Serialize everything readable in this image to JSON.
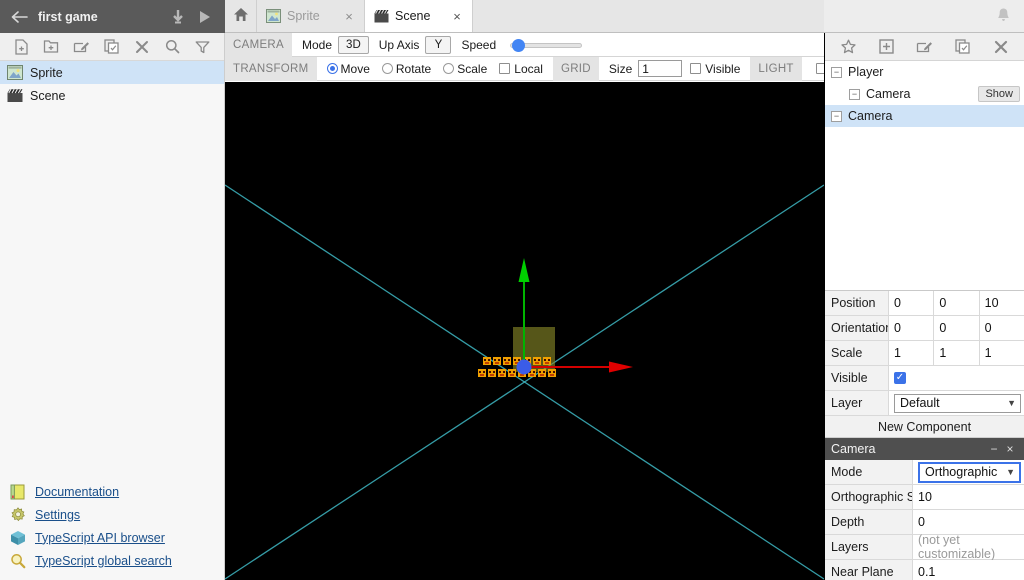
{
  "topbar": {
    "back_icon": "back-arrow-icon",
    "project_title": "first game",
    "export_icon": "download-icon",
    "play_icon": "play-icon",
    "bell_icon": "notification-bell-icon"
  },
  "tabs": {
    "home_icon": "home-icon",
    "items": [
      {
        "label": "Sprite",
        "icon": "image-icon",
        "active": false,
        "close": "×"
      },
      {
        "label": "Scene",
        "icon": "clapperboard-icon",
        "active": true,
        "close": "×"
      }
    ]
  },
  "sidebar": {
    "toolbar": [
      {
        "name": "new-asset-icon"
      },
      {
        "name": "new-folder-icon"
      },
      {
        "name": "rename-icon"
      },
      {
        "name": "duplicate-icon"
      },
      {
        "name": "delete-icon"
      },
      {
        "name": "search-icon"
      },
      {
        "name": "filter-icon"
      }
    ],
    "assets": [
      {
        "label": "Sprite",
        "icon": "image-icon",
        "selected": true
      },
      {
        "label": "Scene",
        "icon": "clapperboard-icon",
        "selected": false
      }
    ],
    "links": [
      {
        "label": "Documentation",
        "icon": "book-icon"
      },
      {
        "label": "Settings",
        "icon": "gear-icon"
      },
      {
        "label": "TypeScript API browser",
        "icon": "package-icon"
      },
      {
        "label": "TypeScript global search",
        "icon": "magnifier-icon"
      }
    ]
  },
  "scene_toolbar": {
    "camera": {
      "section": "CAMERA",
      "mode_label": "Mode",
      "mode_value": "3D",
      "up_axis_label": "Up Axis",
      "up_axis_value": "Y",
      "speed_label": "Speed",
      "speed_percent": 8
    },
    "transform": {
      "section": "TRANSFORM",
      "modes": [
        {
          "label": "Move",
          "selected": true
        },
        {
          "label": "Rotate",
          "selected": false
        },
        {
          "label": "Scale",
          "selected": false
        }
      ],
      "local_label": "Local",
      "local_checked": false
    },
    "grid": {
      "section": "GRID",
      "size_label": "Size",
      "size_value": "1",
      "visible_label": "Visible",
      "visible_checked": false
    },
    "light": {
      "section": "LIGHT",
      "enabled": false
    }
  },
  "viewport": {
    "background": "#000000",
    "x_axis_color": "#d40000",
    "y_axis_color": "#00b400",
    "center_handle_color": "#3b5ce8",
    "plane_handle_color": "#8a8a28",
    "frustum_color": "#3fb8c4",
    "sprite_color": "#f0a000"
  },
  "hierarchy": {
    "toolbar": [
      {
        "name": "new-actor-icon"
      },
      {
        "name": "new-component-icon"
      },
      {
        "name": "rename-icon"
      },
      {
        "name": "duplicate-icon"
      },
      {
        "name": "delete-icon"
      }
    ],
    "nodes": [
      {
        "label": "Player",
        "indent": 0,
        "selected": false,
        "action": ""
      },
      {
        "label": "Camera",
        "indent": 1,
        "selected": false,
        "action": "Show"
      },
      {
        "label": "Camera",
        "indent": 0,
        "selected": true,
        "action": ""
      }
    ]
  },
  "inspector": {
    "transform": [
      {
        "name": "Position",
        "values": [
          "0",
          "0",
          "10"
        ]
      },
      {
        "name": "Orientation",
        "values": [
          "0",
          "0",
          "0"
        ]
      },
      {
        "name": "Scale",
        "values": [
          "1",
          "1",
          "1"
        ]
      }
    ],
    "visible_label": "Visible",
    "visible_checked": true,
    "layer_label": "Layer",
    "layer_value": "Default",
    "new_component_label": "New Component",
    "component": {
      "title": "Camera",
      "minimize": "−",
      "close": "×",
      "rows": [
        {
          "name": "Mode",
          "value": "Orthographic",
          "type": "select",
          "focused": true
        },
        {
          "name": "Orthographic Scale",
          "value": "10",
          "type": "text"
        },
        {
          "name": "Depth",
          "value": "0",
          "type": "text"
        },
        {
          "name": "Layers",
          "value": "(not yet customizable)",
          "type": "muted"
        },
        {
          "name": "Near Plane",
          "value": "0.1",
          "type": "text"
        }
      ]
    }
  }
}
